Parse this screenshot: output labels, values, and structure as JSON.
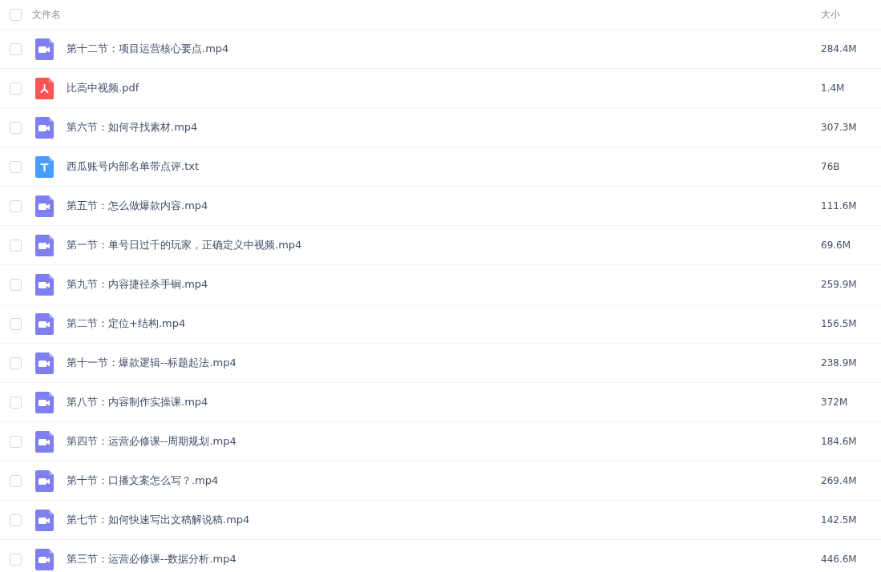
{
  "table": {
    "header": {
      "checked": false,
      "columns": [
        "文件名",
        "大小"
      ]
    },
    "rows": [
      {
        "kind": "video",
        "name": "第十二节：项目运营核心要点.mp4",
        "size": "284.4M",
        "checked": false
      },
      {
        "kind": "pdf",
        "name": "比高中视频.pdf",
        "size": "1.4M",
        "checked": false
      },
      {
        "kind": "video",
        "name": "第六节：如何寻找素材.mp4",
        "size": "307.3M",
        "checked": false
      },
      {
        "kind": "text",
        "name": "西瓜账号内部名单带点评.txt",
        "size": "76B",
        "checked": false
      },
      {
        "kind": "video",
        "name": "第五节：怎么做爆款内容.mp4",
        "size": "111.6M",
        "checked": false
      },
      {
        "kind": "video",
        "name": "第一节：单号日过千的玩家，正确定义中视频.mp4",
        "size": "69.6M",
        "checked": false
      },
      {
        "kind": "video",
        "name": "第九节：内容捷径杀手锏.mp4",
        "size": "259.9M",
        "checked": false
      },
      {
        "kind": "video",
        "name": "第二节：定位+结构.mp4",
        "size": "156.5M",
        "checked": false
      },
      {
        "kind": "video",
        "name": "第十一节：爆款逻辑--标题起法.mp4",
        "size": "238.9M",
        "checked": false
      },
      {
        "kind": "video",
        "name": "第八节：内容制作实操课.mp4",
        "size": "372M",
        "checked": false
      },
      {
        "kind": "video",
        "name": "第四节：运营必修课--周期规划.mp4",
        "size": "184.6M",
        "checked": false
      },
      {
        "kind": "video",
        "name": "第十节：口播文案怎么写？.mp4",
        "size": "269.4M",
        "checked": false
      },
      {
        "kind": "video",
        "name": "第七节：如何快速写出文稿解说稿.mp4",
        "size": "142.5M",
        "checked": false
      },
      {
        "kind": "video",
        "name": "第三节：运营必修课--数据分析.mp4",
        "size": "446.6M",
        "checked": false
      }
    ]
  }
}
